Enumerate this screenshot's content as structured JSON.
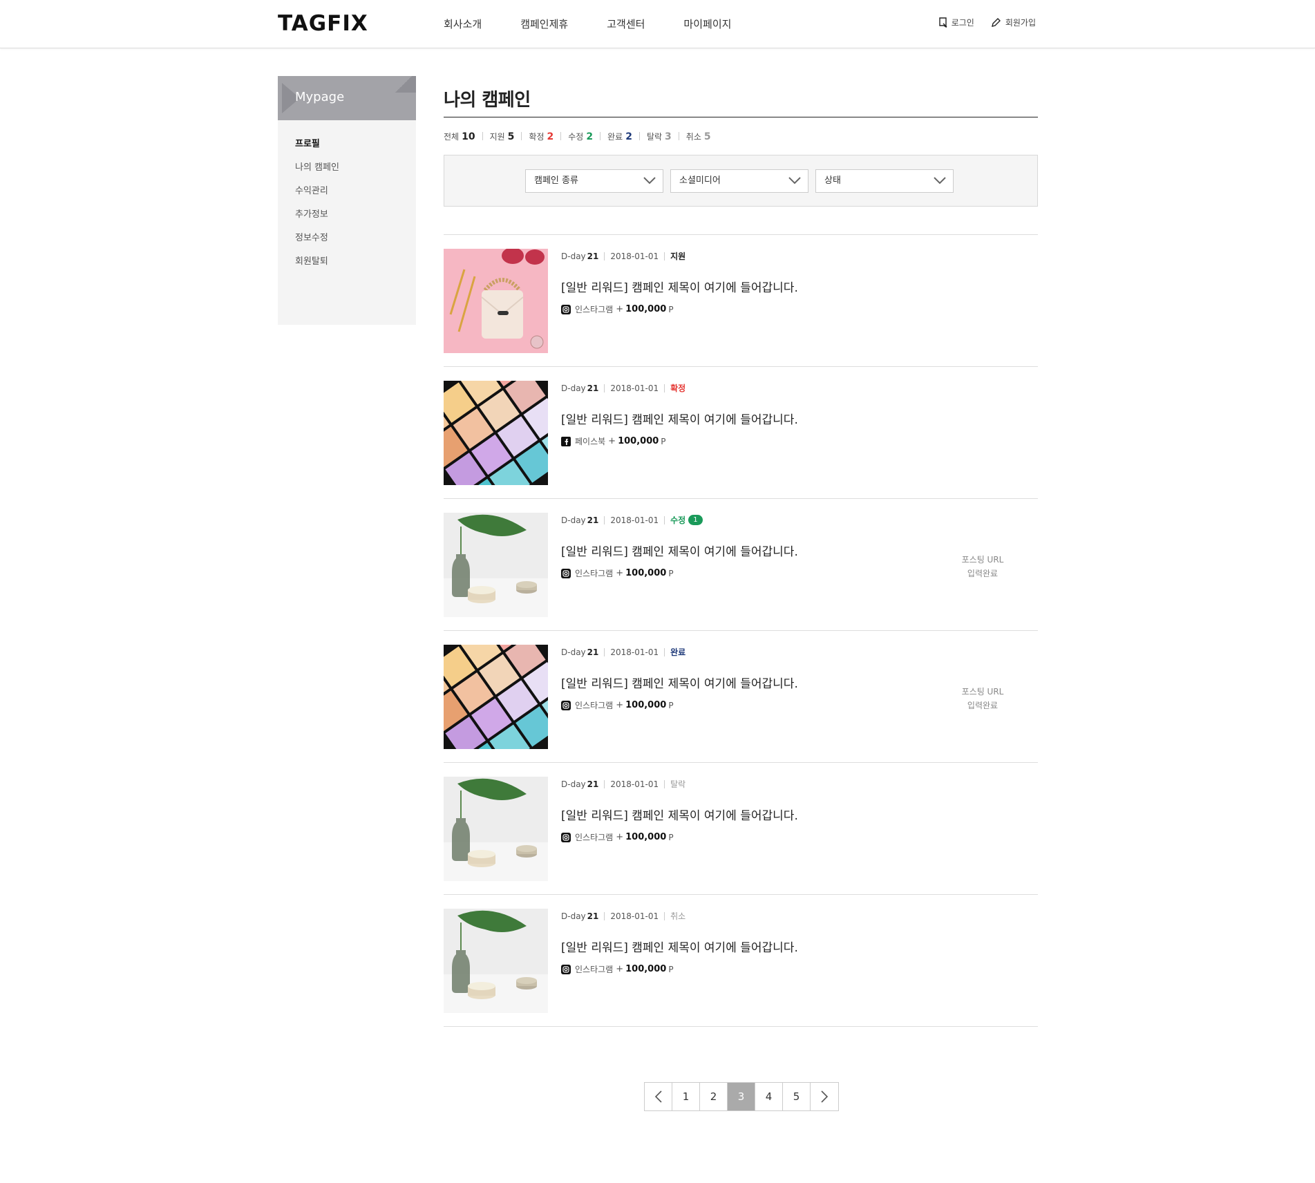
{
  "header": {
    "logo": "TAGFIX",
    "nav": [
      "회사소개",
      "캠페인제휴",
      "고객센터",
      "마이페이지"
    ],
    "login_label": "로그인",
    "signup_label": "회원가입"
  },
  "sidebar": {
    "title": "Mypage",
    "items": [
      {
        "label": "프로필",
        "active": true
      },
      {
        "label": "나의 캠페인",
        "active": false
      },
      {
        "label": "수익관리",
        "active": false
      },
      {
        "label": "추가정보",
        "active": false
      },
      {
        "label": "정보수정",
        "active": false
      },
      {
        "label": "회원탈퇴",
        "active": false
      }
    ]
  },
  "main": {
    "title": "나의 캠페인",
    "stats": [
      {
        "label": "전체",
        "count": "10",
        "color": "#222222"
      },
      {
        "label": "지원",
        "count": "5",
        "color": "#222222"
      },
      {
        "label": "확정",
        "count": "2",
        "color": "#e53935"
      },
      {
        "label": "수정",
        "count": "2",
        "color": "#1a9a5a"
      },
      {
        "label": "완료",
        "count": "2",
        "color": "#1f3a7a"
      },
      {
        "label": "탈락",
        "count": "3",
        "color": "#999999"
      },
      {
        "label": "취소",
        "count": "5",
        "color": "#999999"
      }
    ],
    "filters": [
      "캠페인 종류",
      "소셜미디어",
      "상태"
    ]
  },
  "campaigns": [
    {
      "dday_label": "D-day",
      "dday": "21",
      "date": "2018-01-01",
      "status": "지원",
      "status_color": "#222222",
      "badge": "",
      "title": "[일반 리워드] 캠페인 제목이 여기에 들어갑니다.",
      "media": "인스타그램",
      "media_icon": "instagram-icon",
      "plus": "+",
      "reward": "100,000",
      "unit": "P",
      "posting_line1": "",
      "posting_line2": "",
      "image": "bag"
    },
    {
      "dday_label": "D-day",
      "dday": "21",
      "date": "2018-01-01",
      "status": "확정",
      "status_color": "#e53935",
      "badge": "",
      "title": "[일반 리워드] 캠페인 제목이 여기에 들어갑니다.",
      "media": "페이스북",
      "media_icon": "facebook-icon",
      "plus": "+",
      "reward": "100,000",
      "unit": "P",
      "posting_line1": "",
      "posting_line2": "",
      "image": "palette"
    },
    {
      "dday_label": "D-day",
      "dday": "21",
      "date": "2018-01-01",
      "status": "수정",
      "status_color": "#1a9a5a",
      "badge": "1",
      "title": "[일반 리워드] 캠페인 제목이 여기에 들어갑니다.",
      "media": "인스타그램",
      "media_icon": "instagram-icon",
      "plus": "+",
      "reward": "100,000",
      "unit": "P",
      "posting_line1": "포스팅 URL",
      "posting_line2": "입력완료",
      "image": "cream"
    },
    {
      "dday_label": "D-day",
      "dday": "21",
      "date": "2018-01-01",
      "status": "완료",
      "status_color": "#1f3a7a",
      "badge": "",
      "title": "[일반 리워드] 캠페인 제목이 여기에 들어갑니다.",
      "media": "인스타그램",
      "media_icon": "instagram-icon",
      "plus": "+",
      "reward": "100,000",
      "unit": "P",
      "posting_line1": "포스팅 URL",
      "posting_line2": "입력완료",
      "image": "palette"
    },
    {
      "dday_label": "D-day",
      "dday": "21",
      "date": "2018-01-01",
      "status": "탈락",
      "status_color": "#999999",
      "badge": "",
      "title": "[일반 리워드] 캠페인 제목이 여기에 들어갑니다.",
      "media": "인스타그램",
      "media_icon": "instagram-icon",
      "plus": "+",
      "reward": "100,000",
      "unit": "P",
      "posting_line1": "",
      "posting_line2": "",
      "image": "cream"
    },
    {
      "dday_label": "D-day",
      "dday": "21",
      "date": "2018-01-01",
      "status": "취소",
      "status_color": "#999999",
      "badge": "",
      "title": "[일반 리워드] 캠페인 제목이 여기에 들어갑니다.",
      "media": "인스타그램",
      "media_icon": "instagram-icon",
      "plus": "+",
      "reward": "100,000",
      "unit": "P",
      "posting_line1": "",
      "posting_line2": "",
      "image": "cream"
    }
  ],
  "pagination": {
    "pages": [
      "1",
      "2",
      "3",
      "4",
      "5"
    ],
    "current": "3"
  }
}
